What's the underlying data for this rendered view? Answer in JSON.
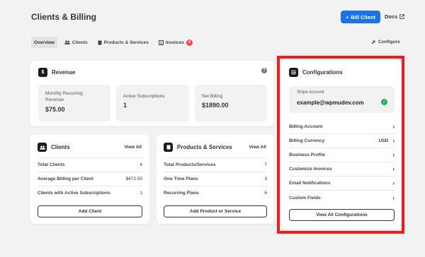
{
  "header": {
    "title": "Clients & Billing",
    "bill_client_label": "Bill Client",
    "docs_label": "Docs"
  },
  "tabs": [
    {
      "label": "Overview",
      "icon": ""
    },
    {
      "label": "Clients",
      "icon": "users-icon"
    },
    {
      "label": "Products & Services",
      "icon": "box-icon"
    },
    {
      "label": "Invoices",
      "icon": "invoice-icon",
      "badge": "4"
    }
  ],
  "configure_label": "Configure",
  "revenue": {
    "title": "Revenue",
    "stats": [
      {
        "label": "Monthly Recurring Revenue",
        "value": "$75.00"
      },
      {
        "label": "Active Subscriptions",
        "value": "1"
      },
      {
        "label": "Net Billing",
        "value": "$1890.00"
      }
    ]
  },
  "clients_card": {
    "title": "Clients",
    "view_all": "View All",
    "rows": [
      {
        "label": "Total Clients",
        "value": "4"
      },
      {
        "label": "Average Billing per Client",
        "value": "$472.50"
      },
      {
        "label": "Clients with Active Subscriptions",
        "value": "1"
      }
    ],
    "button": "Add Client"
  },
  "products_card": {
    "title": "Products & Services",
    "view_all": "View All",
    "rows": [
      {
        "label": "Total Products/Services",
        "value": "7"
      },
      {
        "label": "One Time Plans",
        "value": "3"
      },
      {
        "label": "Recurring Plans",
        "value": "6"
      }
    ],
    "button": "Add Product or Service"
  },
  "configurations": {
    "title": "Configurations",
    "stripe_label": "Stripe Account",
    "stripe_email": "example@wpmudev.com",
    "items": [
      {
        "label": "Billing Account",
        "value": ""
      },
      {
        "label": "Billing Currency",
        "value": "USD"
      },
      {
        "label": "Business Profile",
        "value": ""
      },
      {
        "label": "Customize Invoices",
        "value": ""
      },
      {
        "label": "Email Notifications",
        "value": ""
      },
      {
        "label": "Custom Fields",
        "value": ""
      }
    ],
    "button": "View All Configurations"
  },
  "colors": {
    "primary": "#1a73e8",
    "highlight": "#ee1c1c",
    "success": "#1fb25a",
    "badge": "#ff4a4a"
  }
}
